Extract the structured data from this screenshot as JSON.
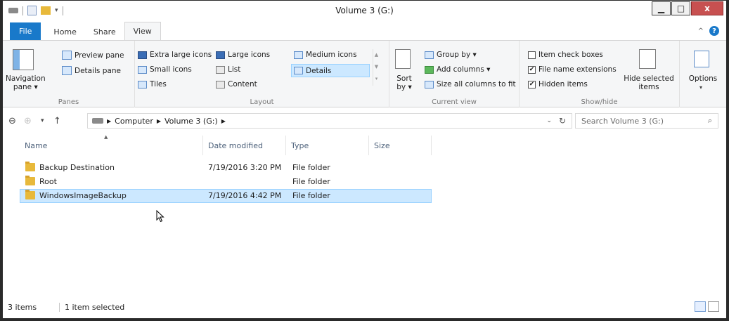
{
  "window": {
    "title": "Volume 3 (G:)",
    "controls": {
      "minimize": "▁",
      "maximize": "□",
      "close": "x"
    }
  },
  "ribbon_tabs": [
    "File",
    "Home",
    "Share",
    "View"
  ],
  "ribbon": {
    "panes": {
      "label": "Panes",
      "navigation_pane": "Navigation pane ▾",
      "preview_pane": "Preview pane",
      "details_pane": "Details pane"
    },
    "layout": {
      "label": "Layout",
      "items": [
        "Extra large icons",
        "Large icons",
        "Medium icons",
        "Small icons",
        "List",
        "Details",
        "Tiles",
        "Content"
      ]
    },
    "current_view": {
      "label": "Current view",
      "sort_by": "Sort by ▾",
      "group_by": "Group by ▾",
      "add_columns": "Add columns ▾",
      "size_all": "Size all columns to fit"
    },
    "show_hide": {
      "label": "Show/hide",
      "item_check_boxes": "Item check boxes",
      "file_name_extensions": "File name extensions",
      "hidden_items": "Hidden items",
      "hide_selected": "Hide selected items"
    },
    "options": "Options"
  },
  "address": {
    "path": [
      "Computer",
      "Volume 3 (G:)"
    ],
    "search_placeholder": "Search Volume 3 (G:)"
  },
  "columns": [
    "Name",
    "Date modified",
    "Type",
    "Size"
  ],
  "files": [
    {
      "name": "Backup Destination",
      "date": "7/19/2016 3:20 PM",
      "type": "File folder",
      "size": ""
    },
    {
      "name": "Root",
      "date": "",
      "type": "File folder",
      "size": ""
    },
    {
      "name": "WindowsImageBackup",
      "date": "7/19/2016 4:42 PM",
      "type": "File folder",
      "size": ""
    }
  ],
  "status": {
    "items": "3 items",
    "selected": "1 item selected"
  }
}
